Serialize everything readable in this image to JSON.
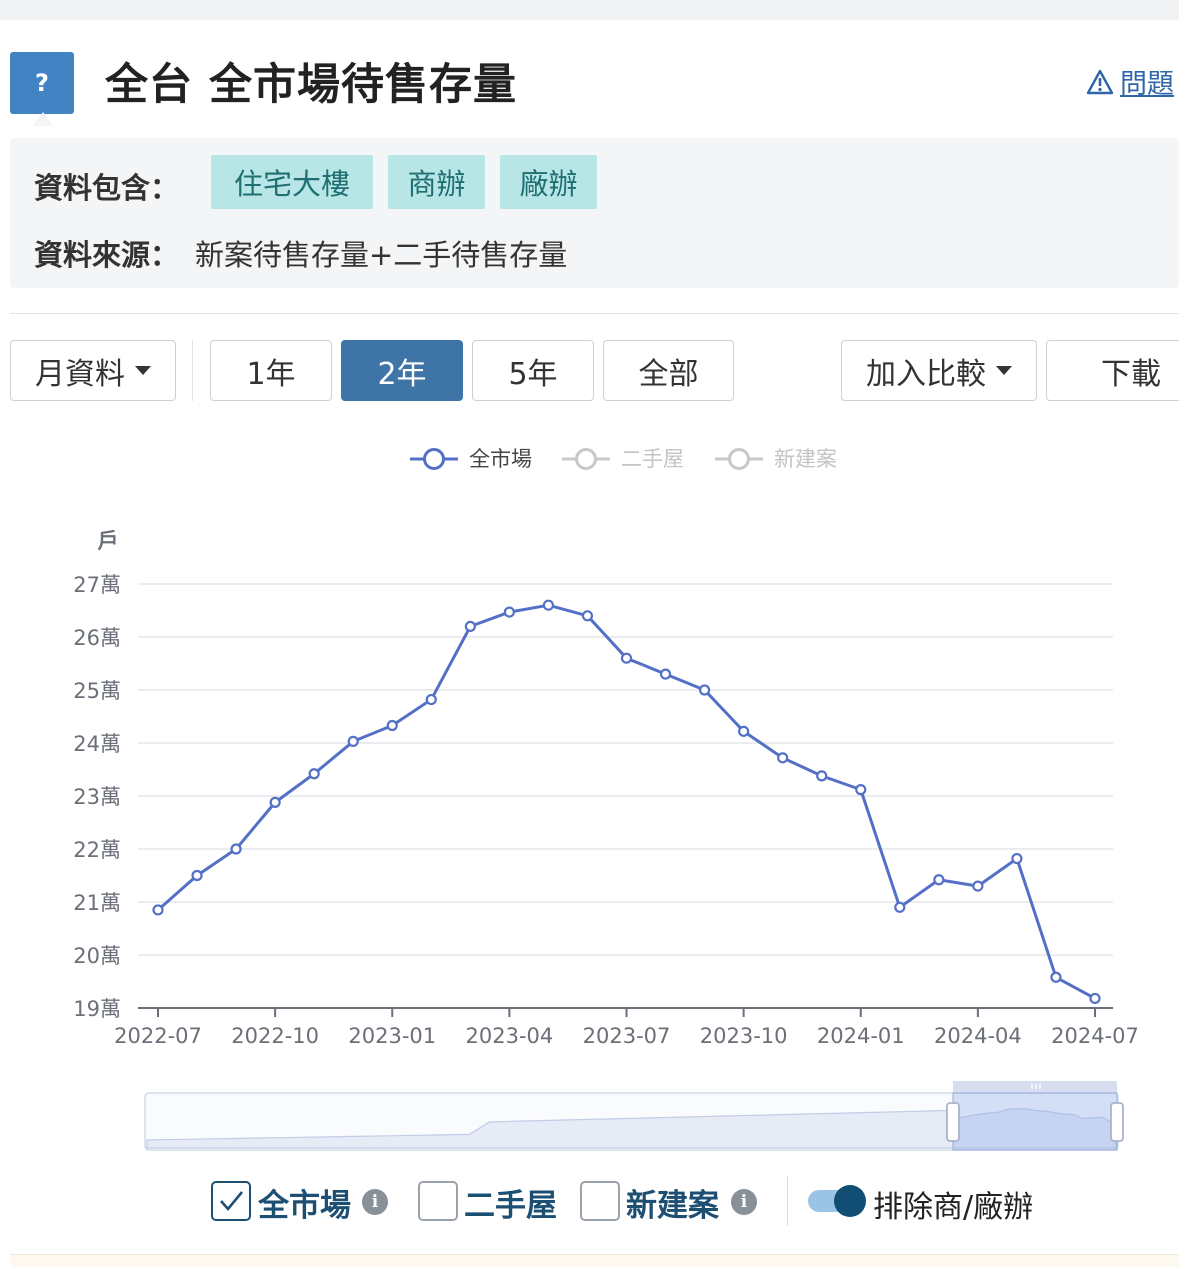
{
  "header": {
    "help": "?",
    "title": "全台 全市場待售存量",
    "report_icon": "warning-triangle-icon",
    "report_label": "問題"
  },
  "info": {
    "includes_label": "資料包含：",
    "tags": [
      "住宅大樓",
      "商辦",
      "廠辦"
    ],
    "source_label": "資料來源：",
    "source_value": "新案待售存量+二手待售存量"
  },
  "toolbar": {
    "period_select": "月資料",
    "ranges": [
      "1年",
      "2年",
      "5年",
      "全部"
    ],
    "active_range": "2年",
    "compare": "加入比較",
    "download": "下載"
  },
  "legend": [
    {
      "name": "全市場",
      "active": true
    },
    {
      "name": "二手屋",
      "active": false
    },
    {
      "name": "新建案",
      "active": false
    }
  ],
  "colors": {
    "series": "#5470c6",
    "accent": "#3e74a6",
    "inactive": "#c8c8c8"
  },
  "chart_data": {
    "type": "line",
    "unit_label": "戶",
    "ylim": [
      19,
      27
    ],
    "y_ticks": [
      "27萬",
      "26萬",
      "25萬",
      "24萬",
      "23萬",
      "22萬",
      "21萬",
      "20萬",
      "19萬"
    ],
    "x_ticks": [
      "2022-07",
      "2022-10",
      "2023-01",
      "2023-04",
      "2023-07",
      "2023-10",
      "2024-01",
      "2024-04",
      "2024-07"
    ],
    "x": [
      "2022-07",
      "2022-08",
      "2022-09",
      "2022-10",
      "2022-11",
      "2022-12",
      "2023-01",
      "2023-02",
      "2023-03",
      "2023-04",
      "2023-05",
      "2023-06",
      "2023-07",
      "2023-08",
      "2023-09",
      "2023-10",
      "2023-11",
      "2023-12",
      "2024-01",
      "2024-02",
      "2024-03",
      "2024-04",
      "2024-05",
      "2024-06",
      "2024-07"
    ],
    "series": [
      {
        "name": "全市場",
        "values": [
          20.85,
          21.5,
          22.0,
          22.88,
          23.42,
          24.03,
          24.33,
          24.82,
          26.2,
          26.47,
          26.6,
          26.4,
          25.6,
          25.3,
          25.0,
          24.22,
          23.72,
          23.38,
          23.12,
          20.9,
          21.42,
          21.3,
          21.82,
          19.58,
          19.18
        ]
      }
    ],
    "grid": true,
    "legend_position": "top-center"
  },
  "bottom": {
    "checkboxes": [
      {
        "label": "全市場",
        "checked": true,
        "info": "i"
      },
      {
        "label": "二手屋",
        "checked": false
      },
      {
        "label": "新建案",
        "checked": false,
        "info": "i"
      }
    ],
    "toggle_label": "排除商/廠辦",
    "toggle_on": true
  }
}
